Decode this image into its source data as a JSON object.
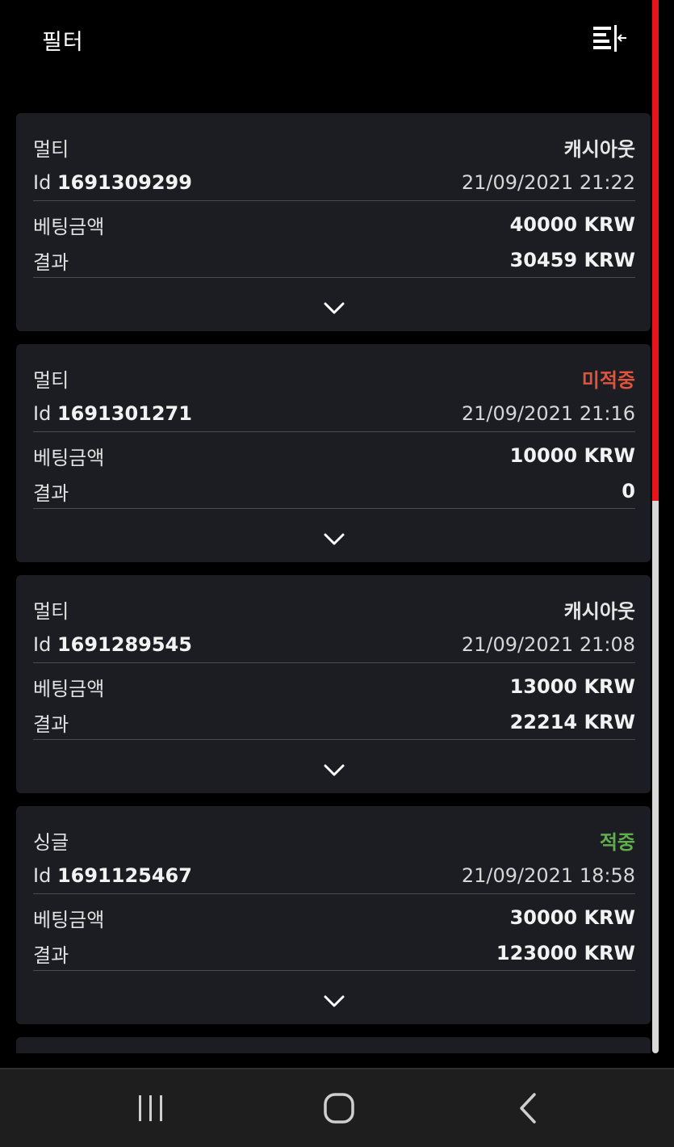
{
  "header": {
    "title": "필터",
    "filter_icon": "filter-collapse-icon"
  },
  "bets": [
    {
      "type": "멀티",
      "status": "캐시아웃",
      "status_kind": "cashout",
      "id_label": "Id",
      "id": "1691309299",
      "datetime": "21/09/2021 21:22",
      "stake_label": "베팅금액",
      "stake": "40000 KRW",
      "result_label": "결과",
      "result": "30459 KRW"
    },
    {
      "type": "멀티",
      "status": "미적중",
      "status_kind": "lost",
      "id_label": "Id",
      "id": "1691301271",
      "datetime": "21/09/2021 21:16",
      "stake_label": "베팅금액",
      "stake": "10000 KRW",
      "result_label": "결과",
      "result": "0"
    },
    {
      "type": "멀티",
      "status": "캐시아웃",
      "status_kind": "cashout",
      "id_label": "Id",
      "id": "1691289545",
      "datetime": "21/09/2021 21:08",
      "stake_label": "베팅금액",
      "stake": "13000 KRW",
      "result_label": "결과",
      "result": "22214 KRW"
    },
    {
      "type": "싱글",
      "status": "적중",
      "status_kind": "won",
      "id_label": "Id",
      "id": "1691125467",
      "datetime": "21/09/2021 18:58",
      "stake_label": "베팅금액",
      "stake": "30000 KRW",
      "result_label": "결과",
      "result": "123000 KRW"
    }
  ],
  "colors": {
    "background": "#000000",
    "card": "#1c1d22",
    "lost": "#e0533c",
    "won": "#5fae4b",
    "scroll_thumb": "#e8141b"
  },
  "navbar": {
    "icons": [
      "recent-apps-icon",
      "home-icon",
      "back-icon"
    ]
  }
}
